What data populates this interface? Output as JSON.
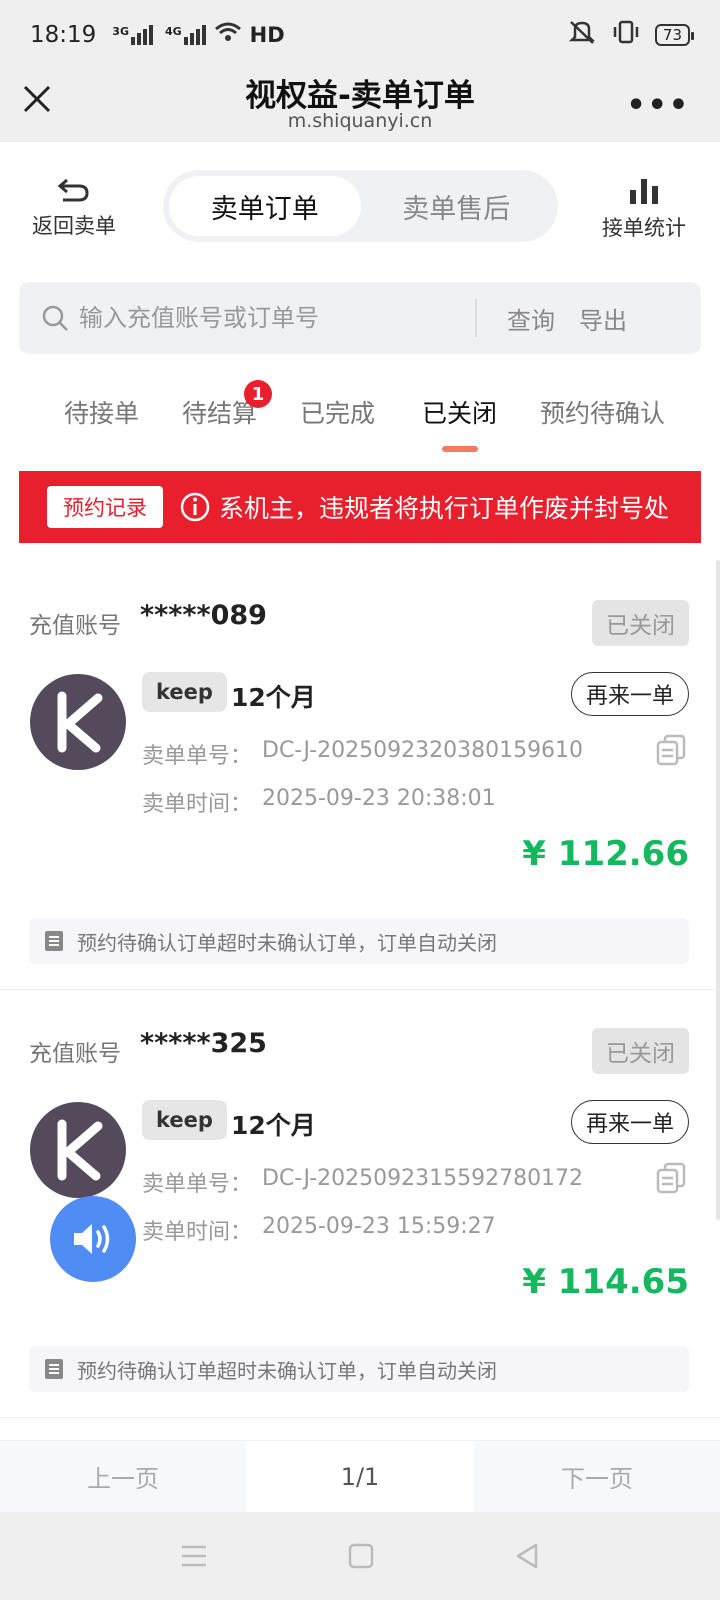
{
  "status_bar": {
    "time": "18:19",
    "net1": "3G",
    "net2": "4G",
    "wifi_label": "HD",
    "battery": "73"
  },
  "titlebar": {
    "title": "视权益-卖单订单",
    "url": "m.shiquanyi.cn",
    "more": "•••"
  },
  "topnav": {
    "back_label": "返回卖单",
    "segments": [
      {
        "label": "卖单订单",
        "active": true
      },
      {
        "label": "卖单售后",
        "active": false
      }
    ],
    "stats_label": "接单统计"
  },
  "search": {
    "placeholder": "输入充值账号或订单号",
    "query_label": "查询",
    "export_label": "导出"
  },
  "tabs": [
    {
      "label": "待接单"
    },
    {
      "label": "待结算",
      "badge": "1"
    },
    {
      "label": "已完成"
    },
    {
      "label": "已关闭",
      "active": true
    },
    {
      "label": "预约待确认"
    }
  ],
  "banner": {
    "button_label": "预约记录",
    "text": "系机主，违规者将执行订单作废并封号处"
  },
  "orders": [
    {
      "account_label": "充值账号",
      "account": "*****089",
      "status": "已关闭",
      "brand": "keep",
      "duration": "12个月",
      "reorder_label": "再来一单",
      "order_no_label": "卖单单号：",
      "order_no": "DC-J-2025092320380159610",
      "time_label": "卖单时间：",
      "time": "2025-09-23 20:38:01",
      "price": "¥ 112.66",
      "note": "预约待确认订单超时未确认订单，订单自动关闭"
    },
    {
      "account_label": "充值账号",
      "account": "*****325",
      "status": "已关闭",
      "brand": "keep",
      "duration": "12个月",
      "reorder_label": "再来一单",
      "order_no_label": "卖单单号：",
      "order_no": "DC-J-2025092315592780172",
      "time_label": "卖单时间：",
      "time": "2025-09-23 15:59:27",
      "price": "¥ 114.65",
      "note": "预约待确认订单超时未确认订单，订单自动关闭"
    }
  ],
  "pager": {
    "prev_label": "上一页",
    "page": "1/1",
    "next_label": "下一页"
  },
  "colors": {
    "accent_red": "#e8202e",
    "price_green": "#16b85f",
    "tab_underline": "#f47b5f",
    "voice_blue": "#4f8df5"
  }
}
